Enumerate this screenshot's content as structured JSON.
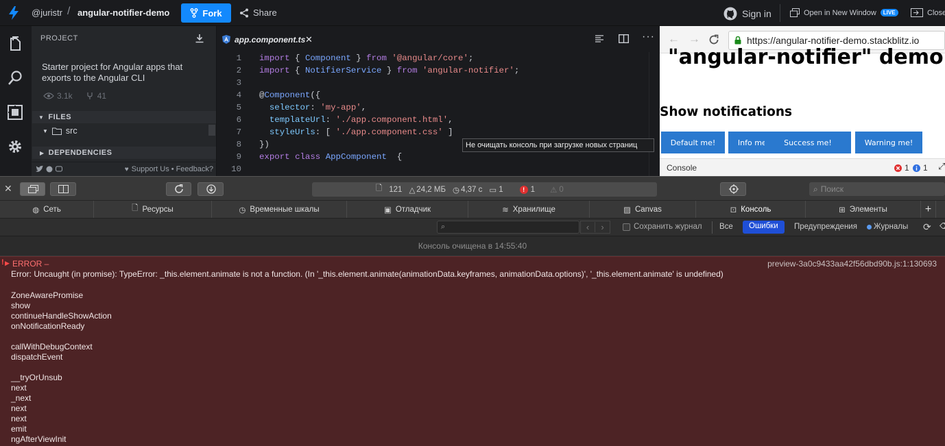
{
  "topbar": {
    "user": "@juristr",
    "slash": "/",
    "project": "angular-notifier-demo",
    "fork_label": "Fork",
    "share_label": "Share",
    "signin_label": "Sign in",
    "open_window_label": "Open in New Window",
    "live_badge": "LIVE",
    "close_label": "Close"
  },
  "sidebar": {
    "project_title": "PROJECT",
    "description": "Starter project for Angular apps that exports to the Angular CLI",
    "views": "3.1k",
    "forks": "41",
    "files_header": "FILES",
    "folder": "src",
    "dependencies_header": "DEPENDENCIES",
    "footer_support": "Support Us",
    "footer_dot": "•",
    "footer_feedback": "Feedback?"
  },
  "editor": {
    "tab_name": "app.component.ts",
    "lines": [
      {
        "n": "1",
        "parts": [
          [
            "k",
            "import"
          ],
          [
            "t",
            " { "
          ],
          [
            "c",
            "Component"
          ],
          [
            "t",
            " } "
          ],
          [
            "k",
            "from"
          ],
          [
            "t",
            " "
          ],
          [
            "s",
            "'@angular/core'"
          ],
          [
            "t",
            ";"
          ]
        ]
      },
      {
        "n": "2",
        "parts": [
          [
            "k",
            "import"
          ],
          [
            "t",
            " { "
          ],
          [
            "c",
            "NotifierService"
          ],
          [
            "t",
            " } "
          ],
          [
            "k",
            "from"
          ],
          [
            "t",
            " "
          ],
          [
            "s",
            "'angular-notifier'"
          ],
          [
            "t",
            ";"
          ]
        ]
      },
      {
        "n": "3",
        "parts": []
      },
      {
        "n": "4",
        "parts": [
          [
            "t",
            "@"
          ],
          [
            "c",
            "Component"
          ],
          [
            "t",
            "({"
          ]
        ]
      },
      {
        "n": "5",
        "parts": [
          [
            "t",
            "  "
          ],
          [
            "d",
            "selector"
          ],
          [
            "t",
            ": "
          ],
          [
            "s",
            "'my-app'"
          ],
          [
            "t",
            ","
          ]
        ]
      },
      {
        "n": "6",
        "parts": [
          [
            "t",
            "  "
          ],
          [
            "d",
            "templateUrl"
          ],
          [
            "t",
            ": "
          ],
          [
            "s",
            "'./app.component.html'"
          ],
          [
            "t",
            ","
          ]
        ]
      },
      {
        "n": "7",
        "parts": [
          [
            "t",
            "  "
          ],
          [
            "d",
            "styleUrls"
          ],
          [
            "t",
            ": [ "
          ],
          [
            "s",
            "'./app.component.css'"
          ],
          [
            "t",
            " ]"
          ]
        ]
      },
      {
        "n": "8",
        "parts": [
          [
            "t",
            "})"
          ]
        ]
      },
      {
        "n": "9",
        "parts": [
          [
            "k",
            "export"
          ],
          [
            "t",
            " "
          ],
          [
            "k",
            "class"
          ],
          [
            "t",
            " "
          ],
          [
            "c",
            "AppComponent"
          ],
          [
            "t",
            "  {"
          ]
        ]
      },
      {
        "n": "10",
        "parts": []
      }
    ],
    "tooltip": "Не очищать консоль при загрузке новых страниц"
  },
  "preview": {
    "url": "https://angular-notifier-demo.stackblitz.io",
    "heading": "\"angular-notifier\" demo",
    "subheading": "Show notifications",
    "buttons": [
      "Default me!",
      "Info me!",
      "Success me!",
      "Warning me!"
    ],
    "console_label": "Console",
    "error_count": "1",
    "info_count": "1"
  },
  "devtools": {
    "status": {
      "resources": "121",
      "size": "24,2 МБ",
      "time": "4,37 с",
      "logs": "1",
      "errors": "1",
      "warnings": "0"
    },
    "search_placeholder": "Поиск",
    "tabs": [
      "Сеть",
      "Ресурсы",
      "Временные шкалы",
      "Отладчик",
      "Хранилище",
      "Canvas",
      "Консоль",
      "Элементы"
    ],
    "filters": {
      "preserve_log": "Сохранить журнал",
      "all": "Все",
      "errors": "Ошибки",
      "warnings": "Предупреждения",
      "logs": "Журналы"
    },
    "cleared_message": "Консоль очищена в 14:55:40",
    "error": {
      "head": "ERROR –",
      "source": "preview-3a0c9433aa42f56dbd90b.js:1:130693",
      "message": "Error: Uncaught (in promise): TypeError: _this.element.animate is not a function. (In '_this.element.animate(animationData.keyframes, animationData.options)', '_this.element.animate' is undefined)",
      "stack": [
        [
          "ZoneAwarePromise",
          "show",
          "continueHandleShowAction",
          "onNotificationReady"
        ],
        [
          "callWithDebugContext",
          "dispatchEvent"
        ],
        [
          "__tryOrUnsub",
          "next",
          "_next",
          "next",
          "next",
          "emit",
          "ngAfterViewInit"
        ]
      ]
    }
  },
  "colors": {
    "accent": "#1389fd",
    "error_bg": "#4d2325",
    "preview_button": "#2a79cf"
  }
}
